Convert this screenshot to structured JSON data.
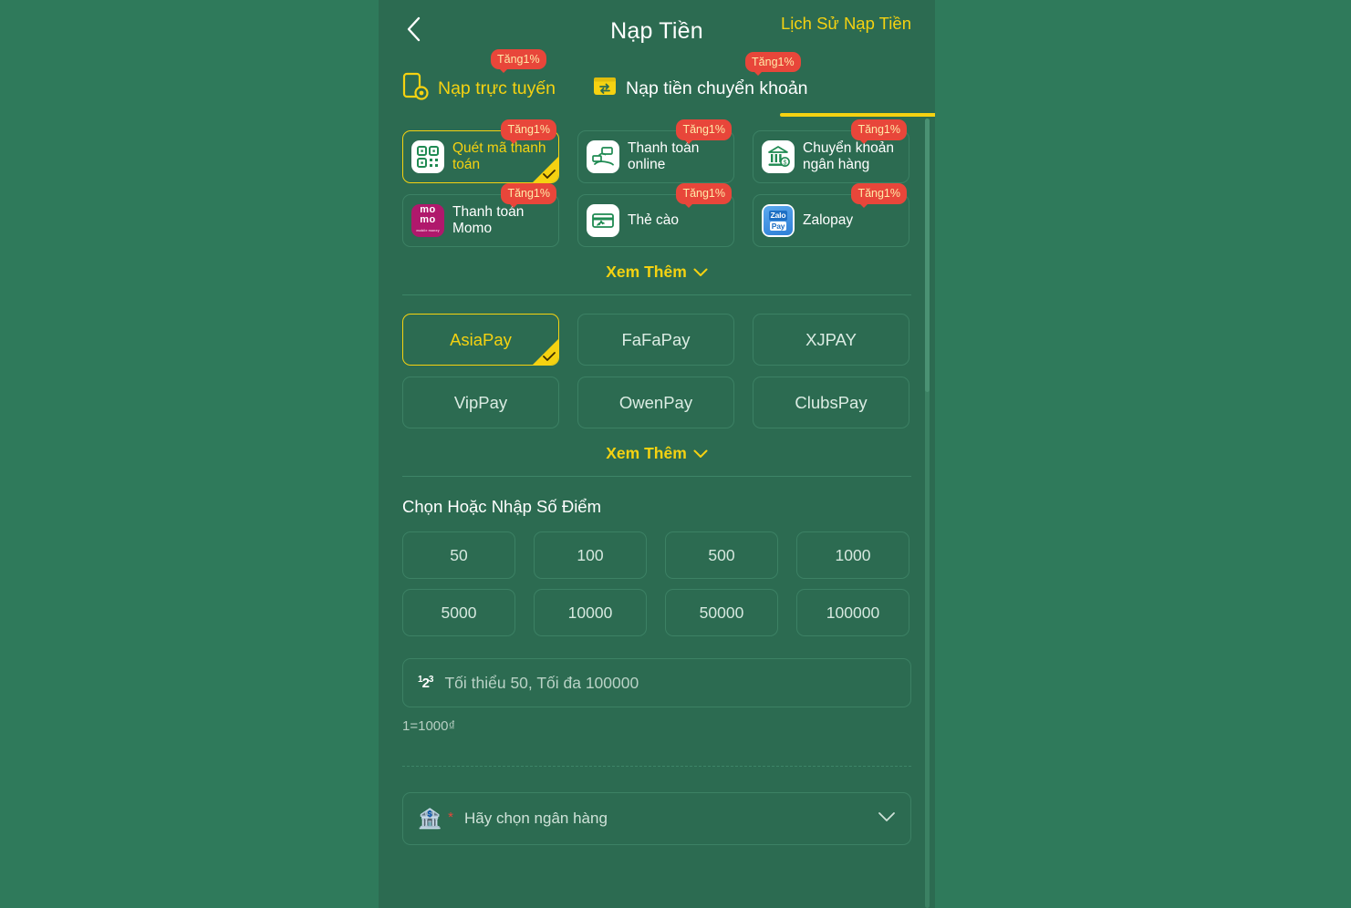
{
  "header": {
    "back_icon": "chevron-left-icon",
    "title": "Nạp Tiền",
    "history_label": "Lịch Sử Nạp Tiền"
  },
  "colors": {
    "page_bg": "#2c6b51",
    "outer_bg": "#2f7a5b",
    "accent_yellow": "#f5d211",
    "badge_red": "#e8463a",
    "border": "#3c8164",
    "text_white": "#ffffff"
  },
  "tabs": [
    {
      "label": "Nạp trực tuyến",
      "icon": "mobile-topup-icon",
      "badge": "Tăng1%",
      "active": true
    },
    {
      "label": "Nạp tiền chuyển khoản",
      "icon": "transfer-card-icon",
      "badge": "Tăng1%",
      "active": false
    }
  ],
  "methods": [
    {
      "label": "Quét mã thanh toán",
      "icon": "qr-code-icon",
      "badge": "Tăng1%",
      "selected": true
    },
    {
      "label": "Thanh toán online",
      "icon": "hand-money-icon",
      "badge": "Tăng1%",
      "selected": false
    },
    {
      "label": "Chuyển khoản ngân hàng",
      "icon": "bank-building-icon",
      "badge": "Tăng1%",
      "selected": false
    },
    {
      "label": "Thanh toán Momo",
      "icon": "momo-logo-icon",
      "badge": "Tăng1%",
      "selected": false
    },
    {
      "label": "Thẻ cào",
      "icon": "scratch-card-icon",
      "badge": "Tăng1%",
      "selected": false
    },
    {
      "label": "Zalopay",
      "icon": "zalopay-logo-icon",
      "badge": "Tăng1%",
      "selected": false
    }
  ],
  "see_more_methods": {
    "label": "Xem Thêm",
    "icon": "chevron-down-icon"
  },
  "providers": [
    {
      "label": "AsiaPay",
      "selected": true
    },
    {
      "label": "FaFaPay",
      "selected": false
    },
    {
      "label": "XJPAY",
      "selected": false
    },
    {
      "label": "VipPay",
      "selected": false
    },
    {
      "label": "OwenPay",
      "selected": false
    },
    {
      "label": "ClubsPay",
      "selected": false
    }
  ],
  "see_more_providers": {
    "label": "Xem Thêm",
    "icon": "chevron-down-icon"
  },
  "amount_section": {
    "title": "Chọn Hoặc Nhập Số Điểm",
    "options": [
      "50",
      "100",
      "500",
      "1000",
      "5000",
      "10000",
      "50000",
      "100000"
    ],
    "input": {
      "icon": "numeric-123-icon",
      "value": "",
      "placeholder": "Tối thiểu 50, Tối đa 100000"
    },
    "rate_note": "1=1000₫"
  },
  "bank_select": {
    "icon": "bank-classical-icon",
    "required_mark": "*",
    "placeholder": "Hãy chọn ngân hàng",
    "chevron": "chevron-down-icon"
  }
}
